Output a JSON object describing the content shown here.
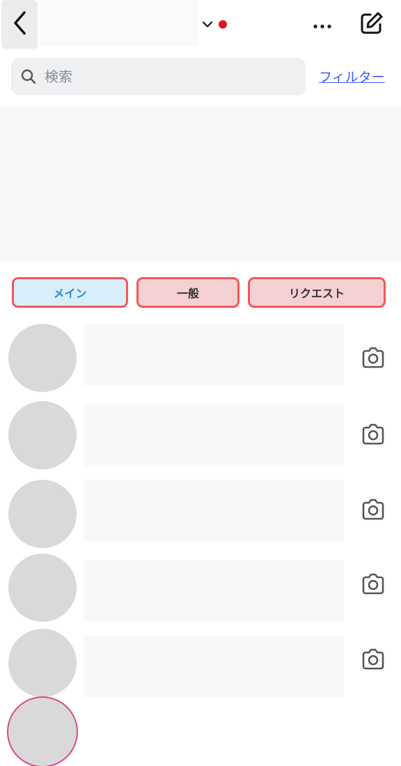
{
  "header": {
    "back_icon": "chevron-left-icon",
    "account_dropdown_icon": "chevron-down-icon",
    "more_icon": "ellipsis-icon",
    "compose_icon": "new-message-icon",
    "notification_color": "#e8121a"
  },
  "search": {
    "placeholder": "検索",
    "icon": "search-icon"
  },
  "filter_label": "フィルター",
  "tabs": [
    {
      "label": "メイン"
    },
    {
      "label": "一般"
    },
    {
      "label": "リクエスト"
    }
  ],
  "conversations": [
    {
      "camera_icon": "camera-icon"
    },
    {
      "camera_icon": "camera-icon"
    },
    {
      "camera_icon": "camera-icon"
    },
    {
      "camera_icon": "camera-icon"
    },
    {
      "camera_icon": "camera-icon"
    }
  ],
  "colors": {
    "link": "#3d5afe",
    "tab_border": "#f0575a",
    "tab_active_bg": "#d9eefb",
    "tab_active_text": "#1d8fd8",
    "tab_inactive_bg": "#f5d0d2"
  }
}
